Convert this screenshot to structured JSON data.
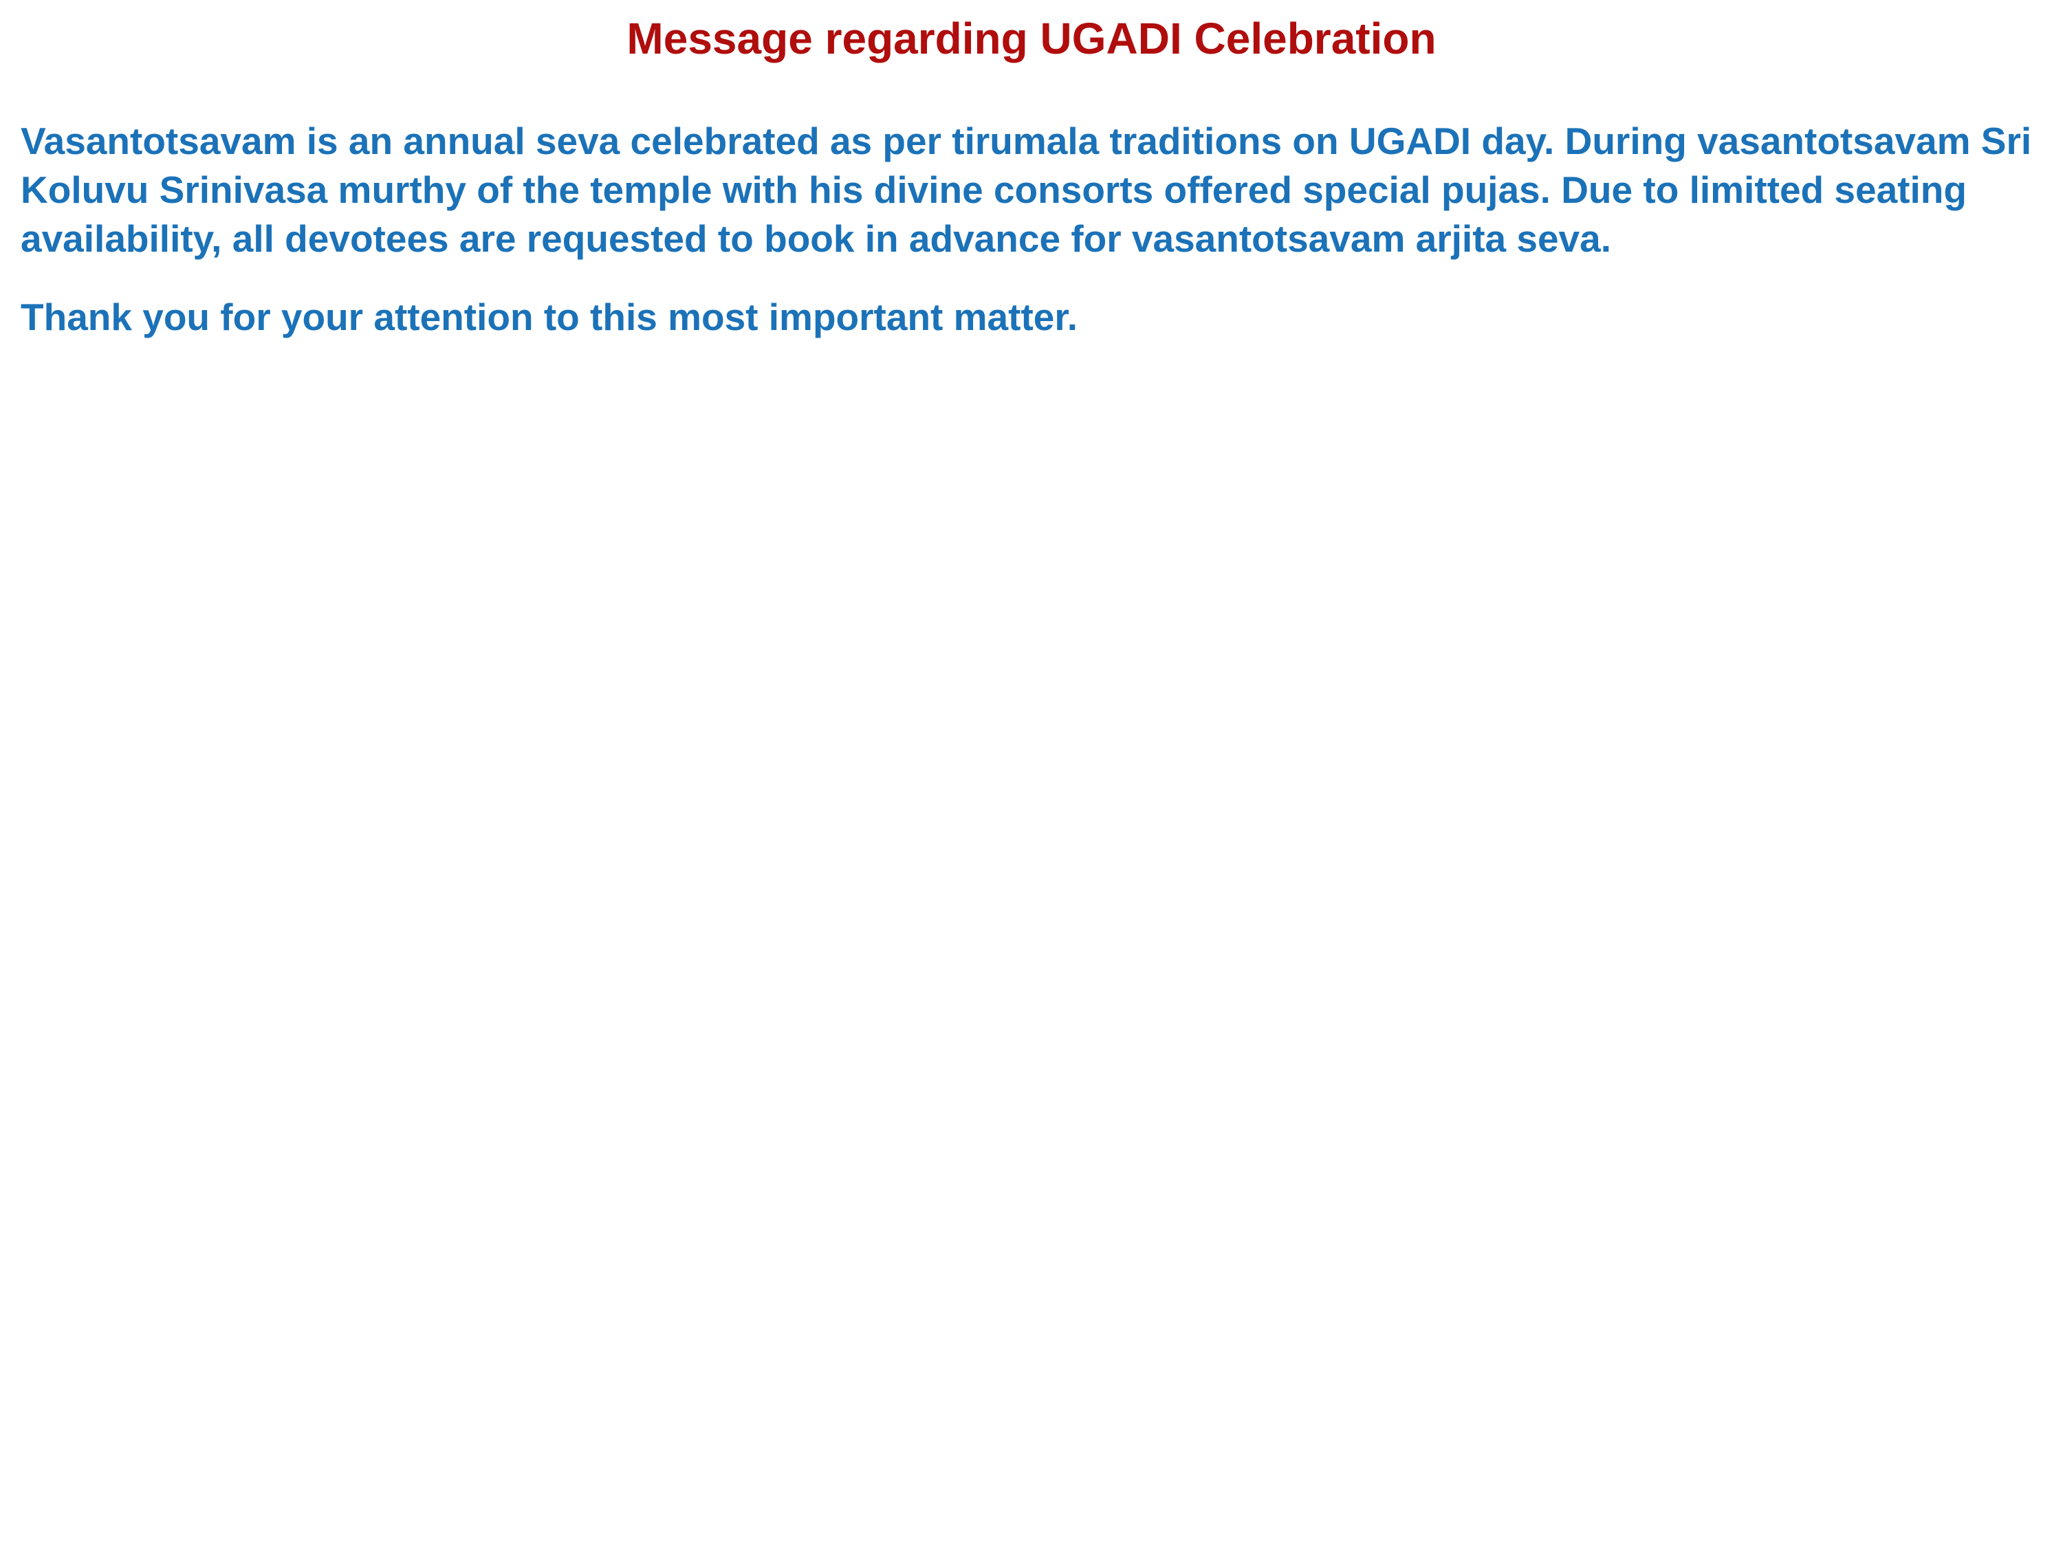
{
  "notice": {
    "title": "Message regarding UGADI Celebration",
    "paragraphs": [
      "Vasantotsavam is an annual seva celebrated as per tirumala traditions on UGADI day. During vasantotsavam Sri Koluvu Srinivasa murthy of the temple with his divine consorts offered special pujas. Due to limitted seating availability, all devotees are requested to book in advance for vasantotsavam arjita seva.",
      "Thank you for your attention to this most important matter."
    ]
  },
  "colors": {
    "title": "#b00d0d",
    "body": "#1b72b8",
    "background": "#ffffff"
  }
}
